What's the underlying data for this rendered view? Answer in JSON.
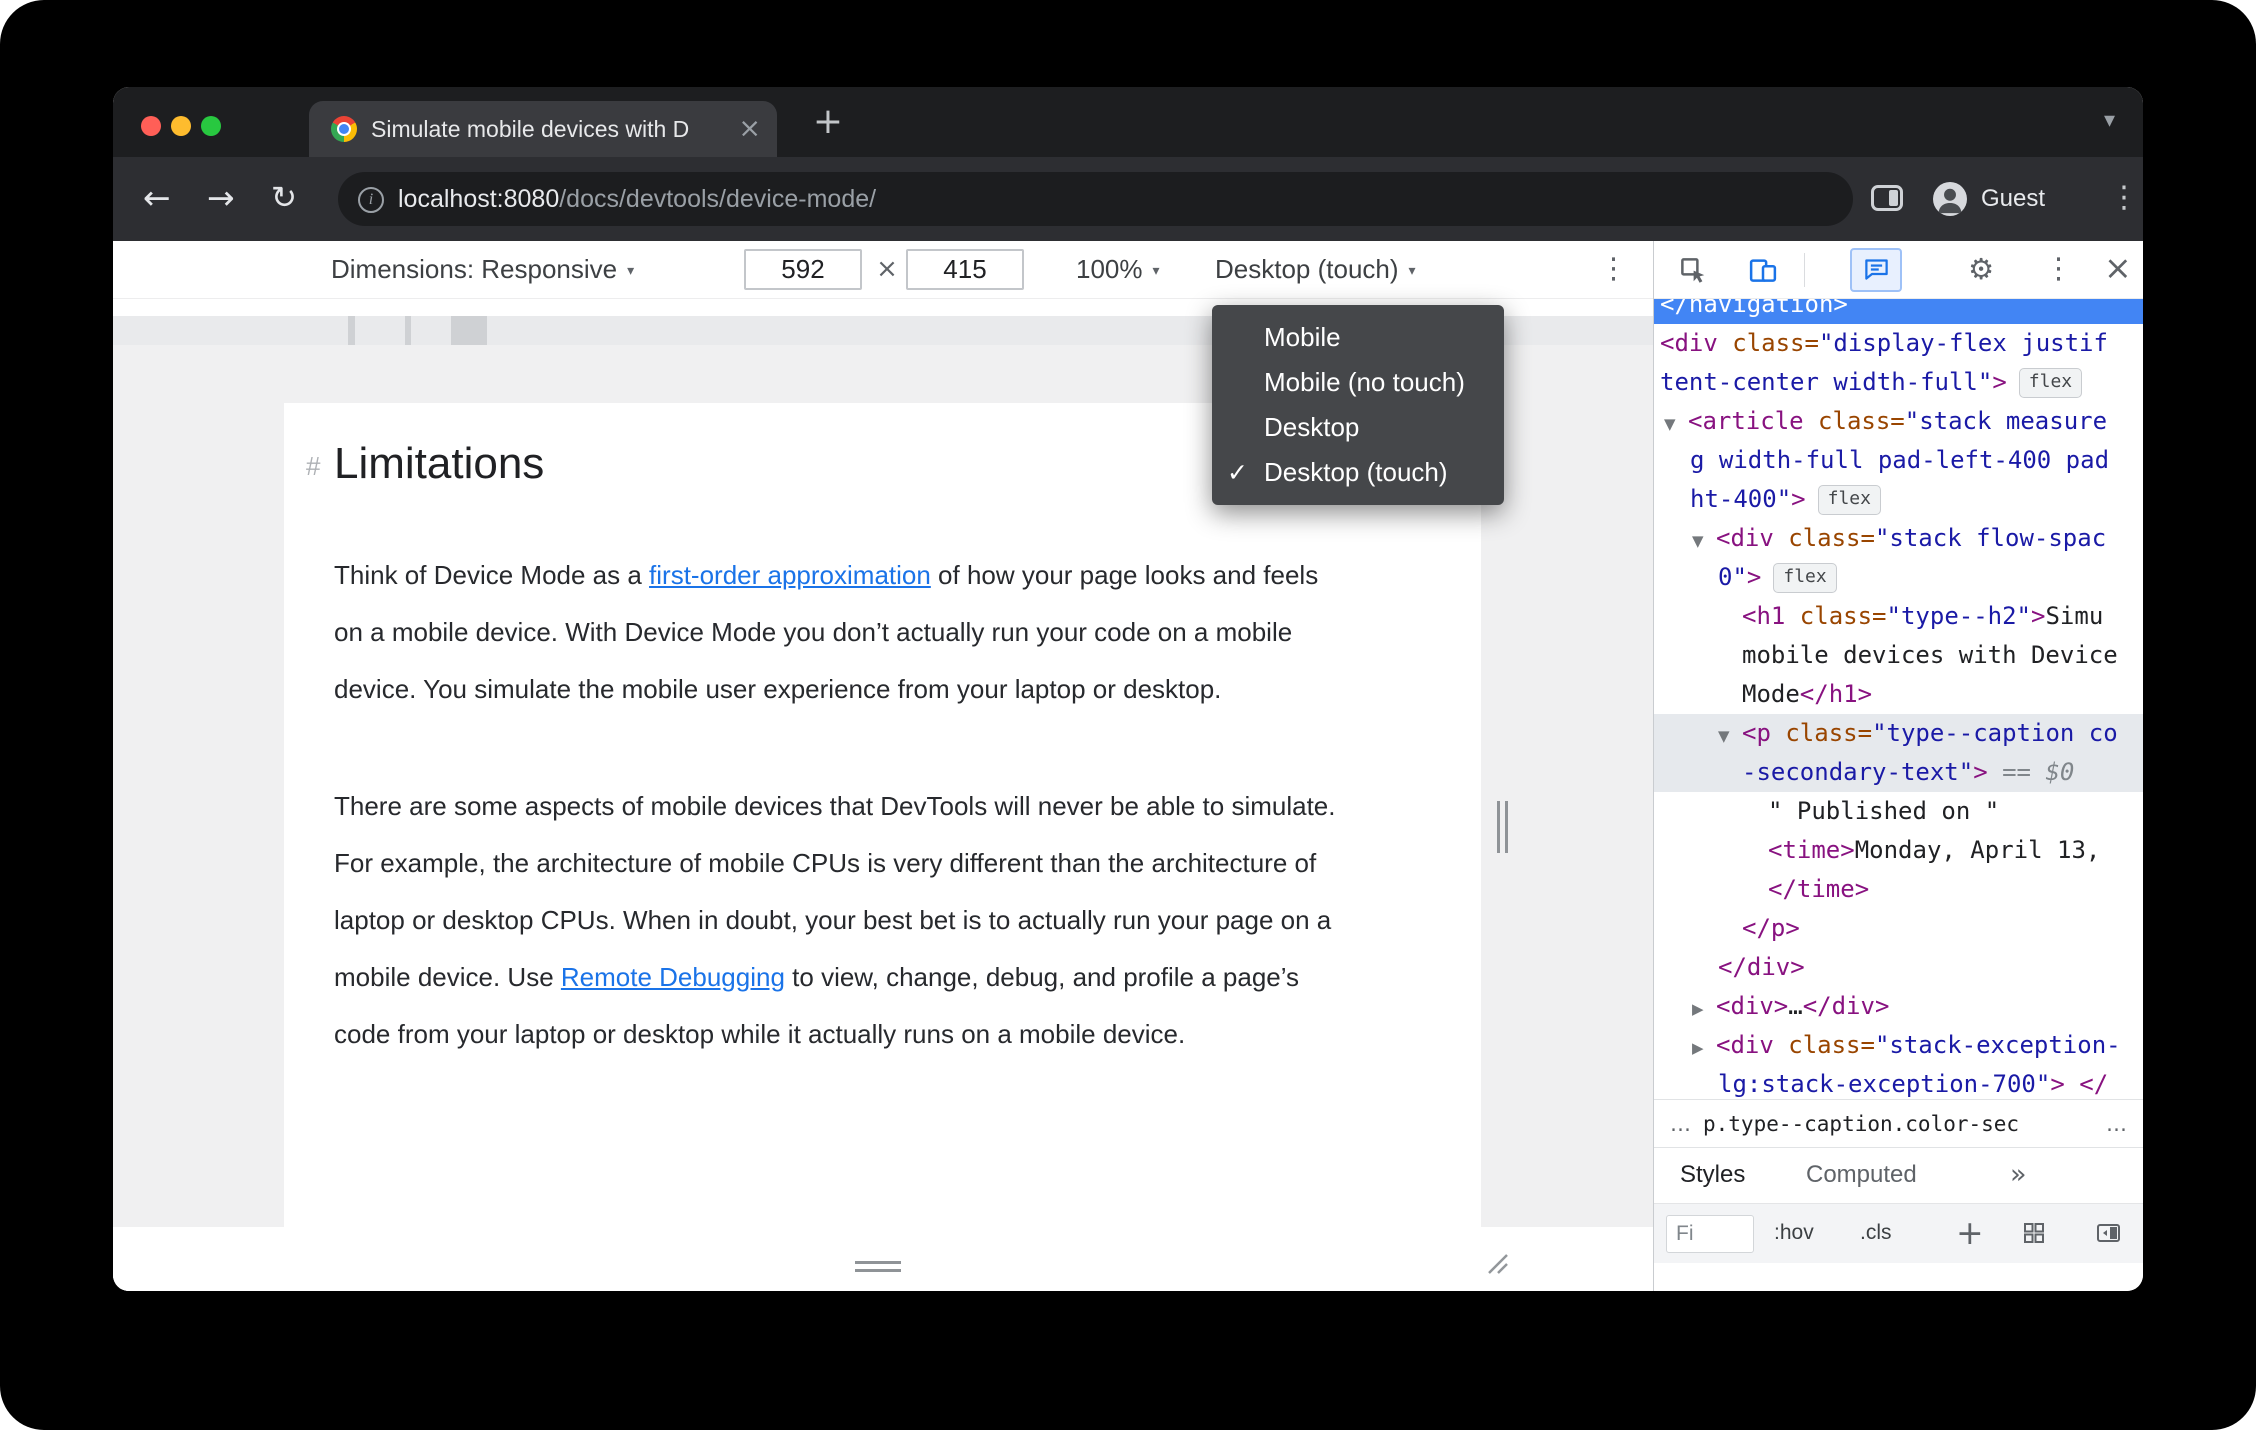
{
  "window": {
    "tab_title": "Simulate mobile devices with D",
    "url_host": "localhost:8080",
    "url_path": "/docs/devtools/device-mode/",
    "guest": "Guest"
  },
  "icons": {
    "close": "×",
    "plus": "+",
    "chevron_down": "▾",
    "caret": "▾",
    "kebab": "⋮",
    "back": "←",
    "forward": "→",
    "reload": "↻",
    "gear": "⚙",
    "more_tabs": "»",
    "info": "i"
  },
  "device_toolbar": {
    "dimensions": "Dimensions: Responsive",
    "width": "592",
    "times": "×",
    "height": "415",
    "zoom": "100%",
    "device": "Desktop (touch)"
  },
  "device_menu": {
    "check": "✓",
    "items": [
      {
        "label": "Mobile",
        "checked": false
      },
      {
        "label": "Mobile (no touch)",
        "checked": false
      },
      {
        "label": "Desktop",
        "checked": false
      },
      {
        "label": "Desktop (touch)",
        "checked": true
      }
    ]
  },
  "article": {
    "hash": "#",
    "title": "Limitations",
    "paragraphs": [
      {
        "segments": [
          {
            "t": "Think of Device Mode as a "
          },
          {
            "t": "first-order approximation",
            "link": true
          },
          {
            "t": " of how your page looks and feels on a mobile device. With Device Mode you don’t actually run your code on a mobile device. You simulate the mobile user experience from your laptop or desktop."
          }
        ]
      },
      {
        "segments": [
          {
            "t": "There are some aspects of mobile devices that DevTools will never be able to simulate. For example, the architecture of mobile CPUs is very different than the architecture of laptop or desktop CPUs. When in doubt, your best bet is to actually run your page on a mobile device. Use "
          },
          {
            "t": "Remote Debugging",
            "link": true
          },
          {
            "t": " to view, change, debug, and profile a page’s code from your laptop or desktop while it actually runs on a mobile device."
          }
        ]
      }
    ]
  },
  "devtools": {
    "flex_badge": "flex",
    "lines": [
      {
        "hl": "blue",
        "ind": 6,
        "segs": [
          [
            "plain",
            "</navigation>"
          ]
        ]
      },
      {
        "ind": 6,
        "segs": [
          [
            "tag",
            "<div"
          ],
          [
            "attr",
            " class="
          ],
          [
            "val",
            "\"display-flex justif"
          ]
        ]
      },
      {
        "ind": 6,
        "segs": [
          [
            "val",
            "tent-center width-full\""
          ],
          [
            "tag",
            ">"
          ]
        ],
        "badge": true
      },
      {
        "ind": 10,
        "arrow": "▼",
        "segs": [
          [
            "tag",
            "<article"
          ],
          [
            "attr",
            " class="
          ],
          [
            "val",
            "\"stack measure"
          ]
        ]
      },
      {
        "ind": 36,
        "segs": [
          [
            "val",
            "g width-full pad-left-400 pad"
          ]
        ]
      },
      {
        "ind": 36,
        "segs": [
          [
            "val",
            "ht-400\""
          ],
          [
            "tag",
            ">"
          ]
        ],
        "badge": true
      },
      {
        "ind": 38,
        "arrow": "▼",
        "segs": [
          [
            "tag",
            "<div"
          ],
          [
            "attr",
            " class="
          ],
          [
            "val",
            "\"stack flow-spac"
          ]
        ]
      },
      {
        "ind": 64,
        "segs": [
          [
            "val",
            "0\""
          ],
          [
            "tag",
            ">"
          ]
        ],
        "badge": true
      },
      {
        "ind": 88,
        "segs": [
          [
            "tag",
            "<h1"
          ],
          [
            "attr",
            " class="
          ],
          [
            "val",
            "\"type--h2\""
          ],
          [
            "tag",
            ">"
          ],
          [
            "txt",
            "Simu"
          ]
        ]
      },
      {
        "ind": 88,
        "segs": [
          [
            "txt",
            "mobile devices with Device"
          ]
        ]
      },
      {
        "ind": 88,
        "segs": [
          [
            "txt",
            "Mode"
          ],
          [
            "tag",
            "</h1>"
          ]
        ]
      },
      {
        "hl": "gray",
        "ind": 64,
        "arrow": "▼",
        "segs": [
          [
            "tag",
            "<p"
          ],
          [
            "attr",
            " class="
          ],
          [
            "val",
            "\"type--caption co"
          ]
        ]
      },
      {
        "hl": "gray",
        "ind": 88,
        "segs": [
          [
            "val",
            "-secondary-text\""
          ],
          [
            "tag",
            ">"
          ],
          [
            "meta",
            " == "
          ],
          [
            "dollar",
            "$0"
          ]
        ]
      },
      {
        "ind": 114,
        "segs": [
          [
            "txt",
            "\" Published on \""
          ]
        ]
      },
      {
        "ind": 114,
        "segs": [
          [
            "tag",
            "<time>"
          ],
          [
            "txt",
            "Monday, April 13,"
          ]
        ]
      },
      {
        "ind": 114,
        "segs": [
          [
            "tag",
            "</time>"
          ]
        ]
      },
      {
        "ind": 88,
        "segs": [
          [
            "tag",
            "</p>"
          ]
        ]
      },
      {
        "ind": 64,
        "segs": [
          [
            "tag",
            "</div>"
          ]
        ]
      },
      {
        "ind": 38,
        "arrow": "▶",
        "segs": [
          [
            "tag",
            "<div>"
          ],
          [
            "txt",
            "…"
          ],
          [
            "tag",
            "</div>"
          ]
        ]
      },
      {
        "ind": 38,
        "arrow": "▶",
        "segs": [
          [
            "tag",
            "<div"
          ],
          [
            "attr",
            " class="
          ],
          [
            "val",
            "\"stack-exception-"
          ]
        ]
      },
      {
        "ind": 64,
        "segs": [
          [
            "val",
            "lg:stack-exception-700\""
          ],
          [
            "tag",
            ">"
          ],
          [
            "txt",
            " "
          ],
          [
            "tag",
            "</"
          ]
        ]
      }
    ],
    "crumb_left": "…",
    "crumb_selected": "p.type--caption.color-sec",
    "crumb_right": "…",
    "sidebar_tabs": [
      "Styles",
      "Computed"
    ],
    "styles_toolbar": {
      "filter": "Fi",
      "hov": ":hov",
      "cls": ".cls",
      "add": "+"
    }
  },
  "colors": {
    "accent_blue": "#1a73e8",
    "syntax_tag": "#881280",
    "syntax_attr": "#994500",
    "syntax_value": "#1a1aa6",
    "selection_blue": "#4285f4"
  }
}
